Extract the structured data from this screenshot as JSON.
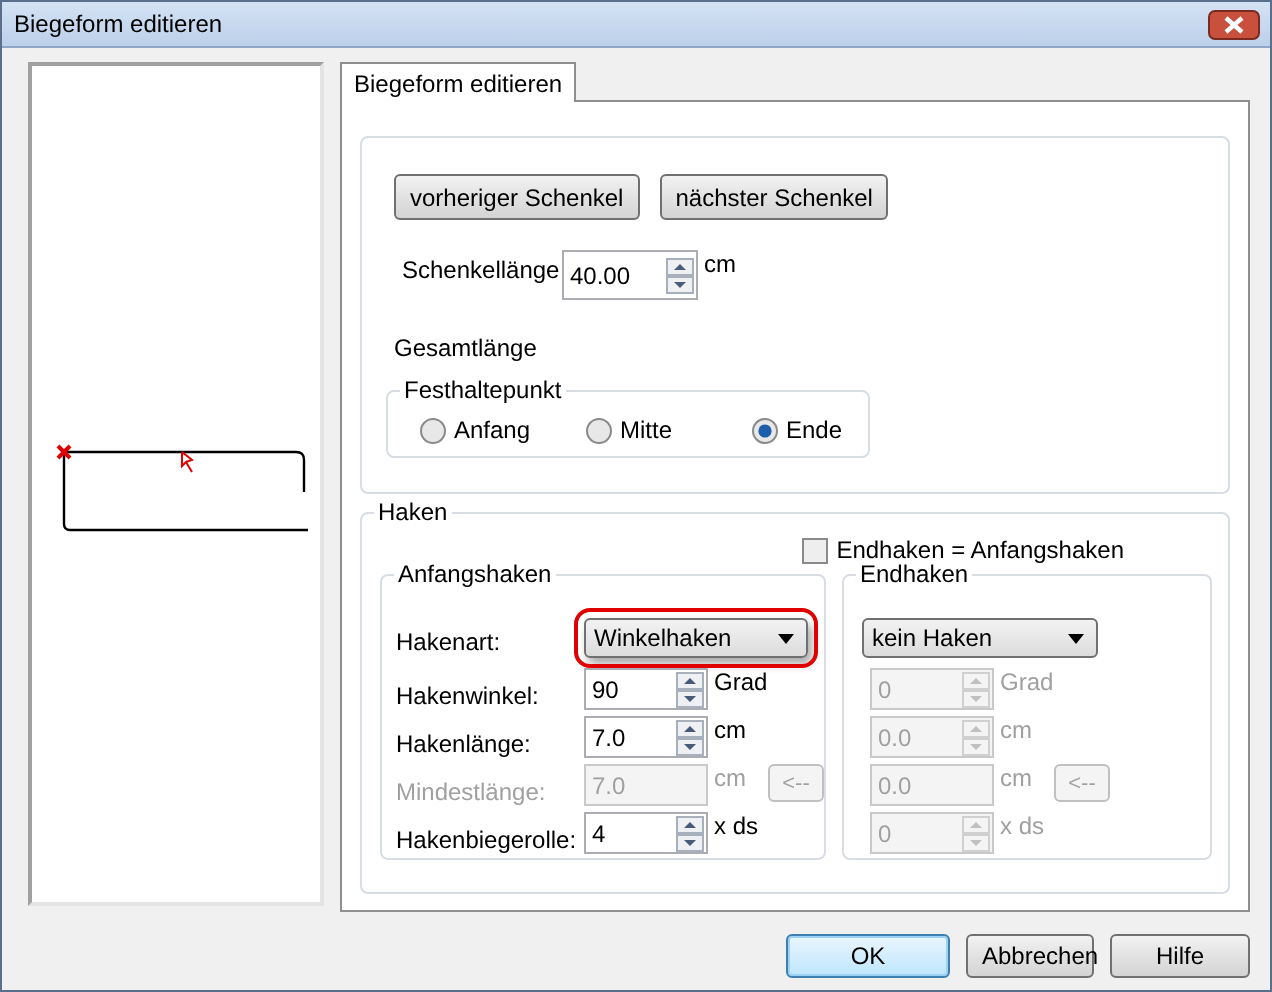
{
  "window": {
    "title": "Biegeform editieren"
  },
  "tabs": [
    {
      "label": "Biegeform editieren",
      "selected": true
    }
  ],
  "segment_buttons": [
    "vorheriger Schenkel",
    "nächster Schenkel"
  ],
  "leg_length": {
    "label": "Schenkellänge",
    "value": "40.00",
    "unit": "cm"
  },
  "total_length": {
    "label": "Gesamtlänge"
  },
  "anchor": {
    "title": "Festhaltepunkt",
    "options": [
      {
        "label": "Anfang",
        "selected": false
      },
      {
        "label": "Mitte",
        "selected": false
      },
      {
        "label": "Ende",
        "selected": true
      }
    ]
  },
  "hooks": {
    "title": "Haken",
    "same_end": {
      "label": "Endhaken = Anfangshaken",
      "checked": false
    },
    "start": {
      "title": "Anfangshaken",
      "type": {
        "label": "Hakenart:",
        "value": "Winkelhaken",
        "highlighted": true
      },
      "rows": [
        {
          "kind": "spin",
          "label": "Hakenwinkel:",
          "value": "90",
          "unit": "Grad",
          "disabled": false
        },
        {
          "kind": "spin",
          "label": "Hakenlänge:",
          "value": "7.0",
          "unit": "cm",
          "disabled": false
        },
        {
          "kind": "reset",
          "label": "Mindestlänge:",
          "value": "7.0",
          "unit": "cm",
          "button": "<--",
          "disabled": true
        },
        {
          "kind": "spin",
          "label": "Hakenbiegerolle:",
          "value": "4",
          "unit": "x ds",
          "disabled": false
        }
      ]
    },
    "end": {
      "title": "Endhaken",
      "type": {
        "value": "kein Haken",
        "highlighted": false
      },
      "rows": [
        {
          "kind": "spin",
          "value": "0",
          "unit": "Grad",
          "disabled": true
        },
        {
          "kind": "spin",
          "value": "0.0",
          "unit": "cm",
          "disabled": true
        },
        {
          "kind": "reset",
          "value": "0.0",
          "unit": "cm",
          "button": "<--",
          "disabled": true
        },
        {
          "kind": "spin",
          "value": "0",
          "unit": "x ds",
          "disabled": true
        }
      ]
    }
  },
  "buttons": [
    {
      "label": "OK",
      "default": true
    },
    {
      "label": "Abbrechen",
      "default": false
    },
    {
      "label": "Hilfe",
      "default": false
    }
  ]
}
